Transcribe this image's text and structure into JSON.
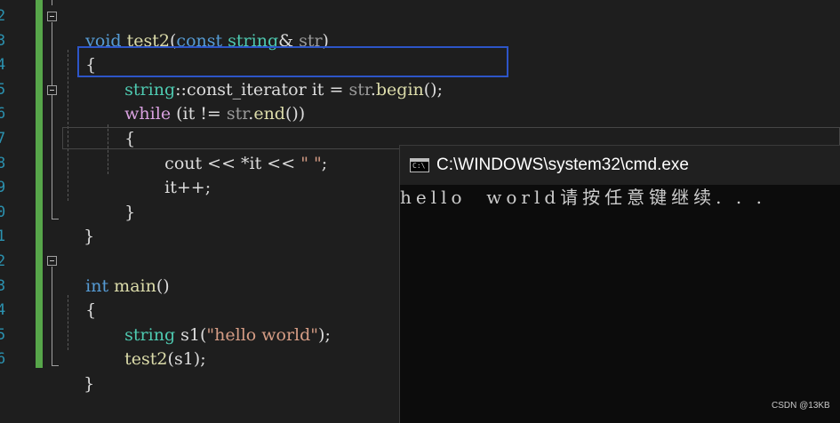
{
  "editor": {
    "line_numbers": [
      "2",
      "3",
      "4",
      "5",
      "6",
      "7",
      "8",
      "9",
      "0",
      "1",
      "2",
      "3",
      "4",
      "5",
      "6"
    ],
    "lines": {
      "l2": {
        "kw": "void",
        "fn": "test2",
        "p1": "(",
        "kw2": "const",
        "ty": "string",
        "p2": "& ",
        "pa": "str",
        "p3": ")"
      },
      "l3": {
        "text": "{"
      },
      "l4": {
        "ty": "string",
        "p1": "::",
        "ty2": "const_iterator",
        "p2": " it = ",
        "pa": "str",
        "p3": ".",
        "fn": "begin",
        "p4": "();"
      },
      "l5": {
        "kw": "while",
        "p1": " (it != ",
        "pa": "str",
        "p2": ".",
        "fn": "end",
        "p3": "())"
      },
      "l6": {
        "text": "{"
      },
      "l7": {
        "fn": "cout",
        "p1": " << *it << ",
        "str": "\" \"",
        "p2": ";"
      },
      "l8": {
        "text": "it++;"
      },
      "l9": {
        "text": "}"
      },
      "l10": {
        "text": "}"
      },
      "l12": {
        "kw": "int",
        "fn": "main",
        "p1": "()"
      },
      "l13": {
        "text": "{"
      },
      "l14": {
        "ty": "string",
        "p1": " s1(",
        "str": "\"hello world\"",
        "p2": ");"
      },
      "l15": {
        "fn": "test2",
        "p1": "(s1);"
      },
      "l16": {
        "text": "}"
      }
    }
  },
  "console": {
    "title": "C:\\WINDOWS\\system32\\cmd.exe",
    "icon_text": "C:\\",
    "output": "hello  world请按任意键继续. . ."
  },
  "watermark": "CSDN @13KB"
}
